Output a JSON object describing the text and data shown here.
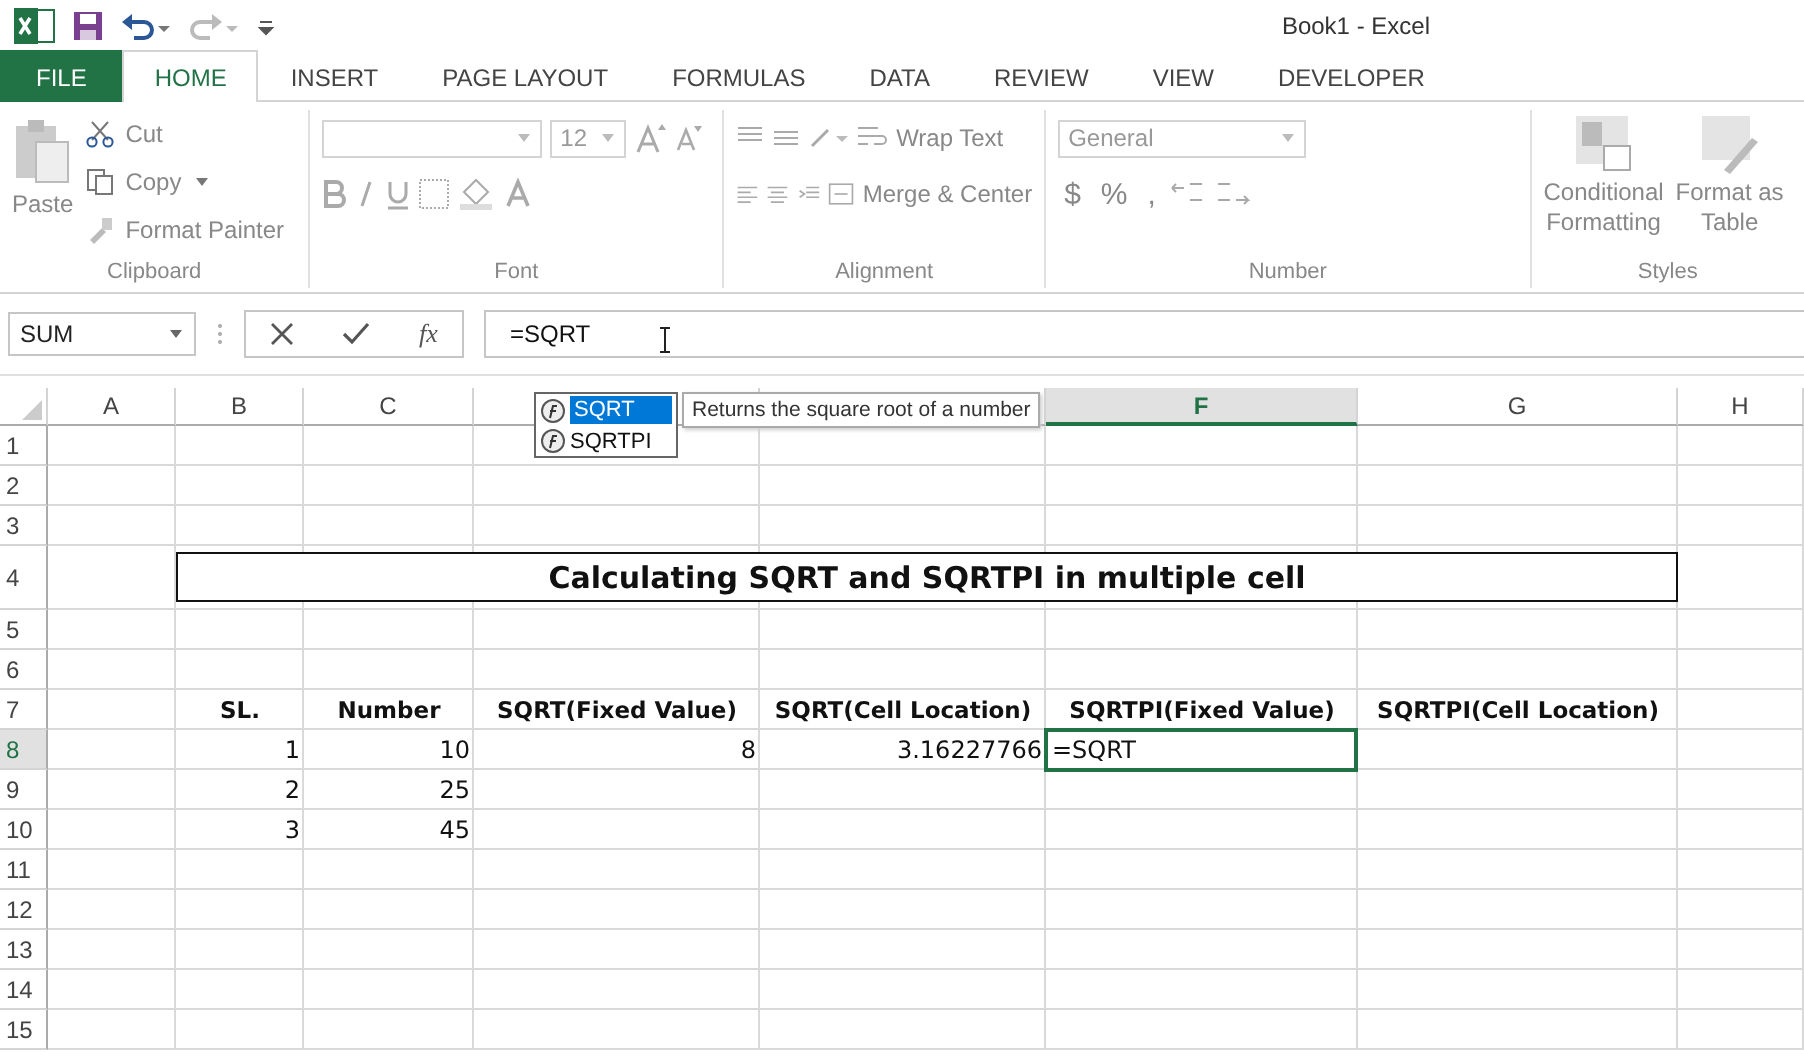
{
  "window": {
    "title": "Book1 - Excel"
  },
  "tabs": [
    {
      "label": "FILE",
      "kind": "file",
      "selected": false
    },
    {
      "label": "HOME",
      "kind": "tab",
      "selected": true
    },
    {
      "label": "INSERT",
      "kind": "tab",
      "selected": false
    },
    {
      "label": "PAGE LAYOUT",
      "kind": "tab",
      "selected": false
    },
    {
      "label": "FORMULAS",
      "kind": "tab",
      "selected": false
    },
    {
      "label": "DATA",
      "kind": "tab",
      "selected": false
    },
    {
      "label": "REVIEW",
      "kind": "tab",
      "selected": false
    },
    {
      "label": "VIEW",
      "kind": "tab",
      "selected": false
    },
    {
      "label": "DEVELOPER",
      "kind": "tab",
      "selected": false
    }
  ],
  "ribbon": {
    "disabled": true,
    "clipboard": {
      "label": "Clipboard",
      "paste": "Paste",
      "cut": "Cut",
      "copy": "Copy",
      "format_painter": "Format Painter"
    },
    "font": {
      "label": "Font",
      "size": "12"
    },
    "alignment": {
      "label": "Alignment",
      "wrap_text": "Wrap Text",
      "merge": "Merge & Center"
    },
    "number": {
      "label": "Number",
      "format": "General",
      "currency": "$",
      "percent": "%",
      "comma": ","
    },
    "styles": {
      "label": "Styles",
      "conditional": [
        "Conditional",
        "Formatting"
      ],
      "table": [
        "Format as",
        "Table"
      ]
    }
  },
  "formula_bar": {
    "name_box": "SUM",
    "formula": "=SQRT",
    "fx": "fx"
  },
  "autocomplete": {
    "items": [
      {
        "label": "SQRT",
        "selected": true
      },
      {
        "label": "SQRTPI",
        "selected": false
      }
    ],
    "tooltip": "Returns the square root of a number"
  },
  "sheet": {
    "merged_title": "Calculating SQRT and SQRTPI in multiple cell",
    "columns": [
      {
        "label": "A",
        "selected": false
      },
      {
        "label": "B",
        "selected": false
      },
      {
        "label": "C",
        "selected": false
      },
      {
        "selected": false
      },
      {
        "selected": false
      },
      {
        "label": "F",
        "selected": true
      },
      {
        "label": "G",
        "selected": false
      },
      {
        "label": "H",
        "selected": false
      }
    ],
    "rows": [
      {
        "header": "1",
        "selected": false,
        "cells": []
      },
      {
        "header": "2",
        "selected": false,
        "cells": []
      },
      {
        "header": "3",
        "selected": false,
        "cells": []
      },
      {
        "header": "4",
        "selected": false,
        "cells": []
      },
      {
        "header": "5",
        "selected": false,
        "cells": []
      },
      {
        "header": "6",
        "selected": false,
        "cells": []
      },
      {
        "header": "7",
        "selected": false,
        "cells": [
          {
            "kind": "empty",
            "text": ""
          },
          {
            "kind": "heading",
            "text": "SL."
          },
          {
            "kind": "heading",
            "text": "Number"
          },
          {
            "kind": "heading",
            "text": "SQRT(Fixed Value)"
          },
          {
            "kind": "heading",
            "text": "SQRT(Cell Location)"
          },
          {
            "kind": "heading",
            "text": "SQRTPI(Fixed Value)"
          },
          {
            "kind": "heading",
            "text": "SQRTPI(Cell Location)"
          }
        ]
      },
      {
        "header": "8",
        "selected": true,
        "cells": [
          {
            "kind": "empty",
            "text": ""
          },
          {
            "kind": "number",
            "text": "1"
          },
          {
            "kind": "number",
            "text": "10"
          },
          {
            "kind": "number",
            "text": "8"
          },
          {
            "kind": "number",
            "text": "3.16227766"
          },
          {
            "kind": "editing",
            "text": "=SQRT"
          }
        ]
      },
      {
        "header": "9",
        "selected": false,
        "cells": [
          {
            "kind": "empty",
            "text": ""
          },
          {
            "kind": "number",
            "text": "2"
          },
          {
            "kind": "number",
            "text": "25"
          }
        ]
      },
      {
        "header": "10",
        "selected": false,
        "cells": [
          {
            "kind": "empty",
            "text": ""
          },
          {
            "kind": "number",
            "text": "3"
          },
          {
            "kind": "number",
            "text": "45"
          }
        ]
      },
      {
        "header": "11",
        "selected": false,
        "cells": []
      },
      {
        "header": "12",
        "selected": false,
        "cells": []
      },
      {
        "header": "13",
        "selected": false,
        "cells": []
      },
      {
        "header": "14",
        "selected": false,
        "cells": []
      },
      {
        "header": "15",
        "selected": false,
        "cells": []
      }
    ]
  }
}
